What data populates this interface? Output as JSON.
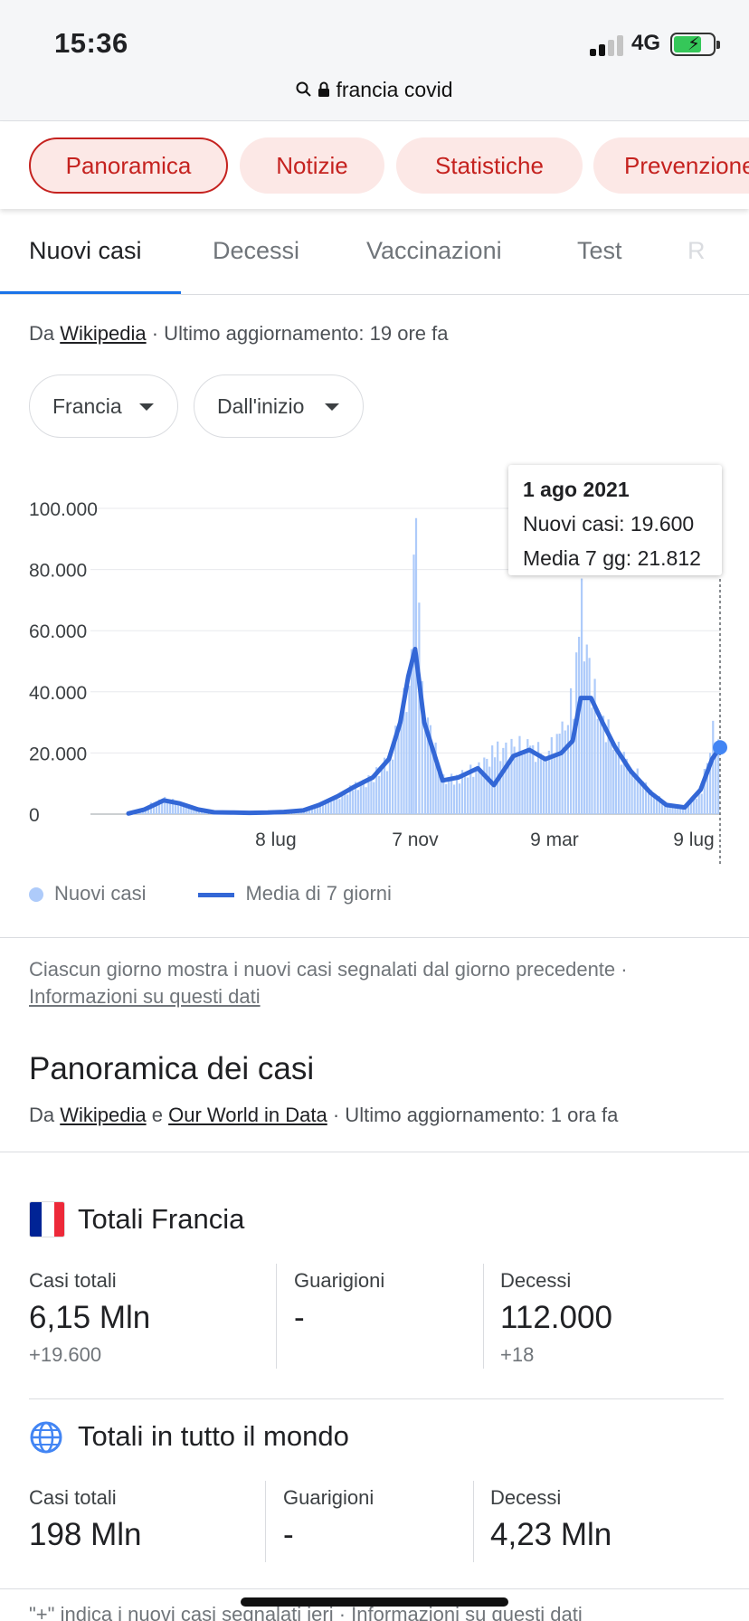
{
  "status": {
    "time": "15:36",
    "network": "4G"
  },
  "url": {
    "text": "francia covid"
  },
  "chips": [
    "Panoramica",
    "Notizie",
    "Statistiche",
    "Prevenzione"
  ],
  "tabs": [
    "Nuovi casi",
    "Decessi",
    "Vaccinazioni",
    "Test",
    "R"
  ],
  "source": {
    "prefix": "Da ",
    "link": "Wikipedia",
    "suffix": " · Ultimo aggiornamento: 19 ore fa"
  },
  "filters": {
    "region": "Francia",
    "period": "Dall'inizio"
  },
  "tooltip": {
    "date": "1 ago 2021",
    "cases": "Nuovi casi: 19.600",
    "avg": "Media 7 gg: 21.812"
  },
  "legend": {
    "daily": "Nuovi casi",
    "avg": "Media di 7 giorni"
  },
  "note": {
    "text": "Ciascun giorno mostra i nuovi casi segnalati dal giorno precedente · ",
    "link": "Informazioni su questi dati"
  },
  "overview": {
    "title": "Panoramica dei casi",
    "prefix": "Da ",
    "link1": "Wikipedia",
    "mid": " e ",
    "link2": "Our World in Data",
    "suffix": " · Ultimo aggiornamento: 1 ora fa"
  },
  "france": {
    "title": "Totali Francia",
    "cases_label": "Casi totali",
    "cases_value": "6,15 Mln",
    "cases_delta": "+19.600",
    "recovered_label": "Guarigioni",
    "recovered_value": "-",
    "deaths_label": "Decessi",
    "deaths_value": "112.000",
    "deaths_delta": "+18"
  },
  "world": {
    "title": "Totali in tutto il mondo",
    "cases_label": "Casi totali",
    "cases_value": "198 Mln",
    "recovered_label": "Guarigioni",
    "recovered_value": "-",
    "deaths_label": "Decessi",
    "deaths_value": "4,23 Mln"
  },
  "footer": {
    "text": "\"+\" indica i nuovi casi segnalati ieri  ·  Informazioni su questi dati"
  },
  "colors": {
    "bars": "#aecbfa",
    "avg_line": "#3367d6",
    "chip_text": "#c5221f",
    "chip_bg": "#fce8e6",
    "flag": [
      "#002395",
      "#ffffff",
      "#ed2939"
    ]
  },
  "chart_data": {
    "type": "bar",
    "title": "",
    "xlabel": "",
    "ylabel": "",
    "ylim": [
      0,
      100000
    ],
    "y_ticks": [
      "100.000",
      "80.000",
      "60.000",
      "40.000",
      "20.000",
      "0"
    ],
    "x_ticks": [
      "8 lug",
      "7 nov",
      "9 mar",
      "9 lug"
    ],
    "grid": true,
    "legend": "bottom",
    "series": [
      {
        "name": "Nuovi casi",
        "kind": "bar",
        "x": [
          "2020-03-01",
          "2020-03-15",
          "2020-04-01",
          "2020-04-15",
          "2020-05-01",
          "2020-05-15",
          "2020-06-01",
          "2020-06-15",
          "2020-07-01",
          "2020-07-15",
          "2020-08-01",
          "2020-08-15",
          "2020-09-01",
          "2020-09-15",
          "2020-10-01",
          "2020-10-15",
          "2020-10-25",
          "2020-11-01",
          "2020-11-07",
          "2020-11-15",
          "2020-12-01",
          "2020-12-15",
          "2021-01-01",
          "2021-01-15",
          "2021-02-01",
          "2021-02-15",
          "2021-03-01",
          "2021-03-15",
          "2021-03-25",
          "2021-04-01",
          "2021-04-10",
          "2021-04-20",
          "2021-05-01",
          "2021-05-15",
          "2021-06-01",
          "2021-06-15",
          "2021-07-01",
          "2021-07-15",
          "2021-07-25",
          "2021-08-01"
        ],
        "values": [
          300,
          2500,
          5000,
          3500,
          1500,
          600,
          500,
          400,
          500,
          700,
          1200,
          3000,
          6000,
          9000,
          12000,
          18000,
          32000,
          45000,
          86000,
          33000,
          11000,
          12000,
          15000,
          20000,
          22000,
          21000,
          20000,
          26000,
          38000,
          66000,
          40000,
          30000,
          22000,
          15000,
          7000,
          3000,
          2200,
          8000,
          27000,
          19600
        ]
      },
      {
        "name": "Media di 7 giorni",
        "kind": "line",
        "x": [
          "2020-03-01",
          "2020-03-15",
          "2020-04-01",
          "2020-04-15",
          "2020-05-01",
          "2020-05-15",
          "2020-06-01",
          "2020-06-15",
          "2020-07-01",
          "2020-07-15",
          "2020-08-01",
          "2020-08-15",
          "2020-09-01",
          "2020-09-15",
          "2020-10-01",
          "2020-10-15",
          "2020-10-25",
          "2020-11-01",
          "2020-11-07",
          "2020-11-15",
          "2020-12-01",
          "2020-12-15",
          "2021-01-01",
          "2021-01-15",
          "2021-02-01",
          "2021-02-15",
          "2021-03-01",
          "2021-03-15",
          "2021-03-25",
          "2021-04-01",
          "2021-04-10",
          "2021-04-20",
          "2021-05-01",
          "2021-05-15",
          "2021-06-01",
          "2021-06-15",
          "2021-07-01",
          "2021-07-15",
          "2021-07-25",
          "2021-08-01"
        ],
        "values": [
          200,
          1500,
          4500,
          3500,
          1500,
          600,
          500,
          400,
          500,
          700,
          1200,
          3000,
          6000,
          9000,
          12000,
          18000,
          30000,
          45000,
          54000,
          30000,
          11000,
          12000,
          15000,
          9500,
          19000,
          21000,
          18000,
          20000,
          24000,
          38000,
          38000,
          30000,
          22000,
          14000,
          7000,
          3000,
          2200,
          8000,
          18000,
          21812
        ]
      }
    ]
  }
}
